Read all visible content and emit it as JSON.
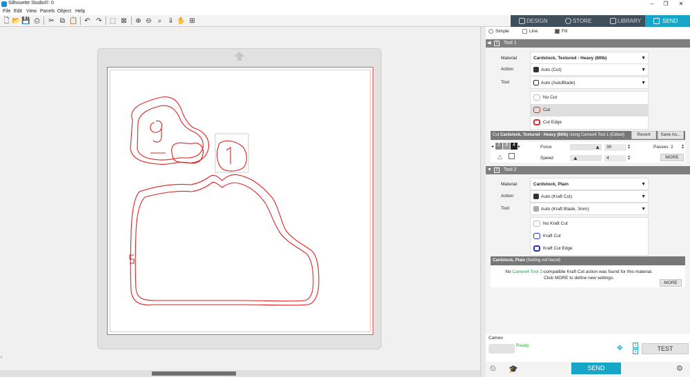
{
  "app": {
    "title": "Silhouette Studio®: 0"
  },
  "menu": [
    "File",
    "Edit",
    "View",
    "Panels",
    "Object",
    "Help"
  ],
  "nav_tabs": [
    {
      "label": "DESIGN",
      "active": false
    },
    {
      "label": "STORE",
      "active": false
    },
    {
      "label": "LIBRARY",
      "active": false
    },
    {
      "label": "SEND",
      "active": true
    }
  ],
  "colors": {
    "accent": "#18a6c8",
    "nav_bg": "#3f4f5c",
    "cut_line": "#e02020",
    "ready": "#22bb22"
  },
  "modes": [
    "Simple",
    "Line",
    "Fill"
  ],
  "tool1": {
    "header": "Tool 1",
    "material_label": "Material",
    "material_value": "Cardstock, Textured - Heavy (80lb)",
    "action_label": "Action",
    "action_value": "Auto (Cut)",
    "tool_label": "Tool",
    "tool_value": "Auto (AutoBlade)",
    "actions": [
      "No Cut",
      "Cut",
      "Cut Edge"
    ],
    "selected_action": "Cut",
    "info_prefix": "Cut ",
    "info_material": "Cardstock, Textured - Heavy (80lb)",
    "info_suffix": " Using Cameo4 Tool 1 (Edited)",
    "revert": "Revert",
    "save_as": "Save As...",
    "blade_nums": [
      "2",
      "3",
      "4"
    ],
    "force_label": "Force",
    "force_value": "30",
    "passes_label": "Passes",
    "passes_value": "2",
    "speed_label": "Speed",
    "speed_value": "4",
    "more": "MORE"
  },
  "tool2": {
    "header": "Tool 2",
    "material_label": "Material",
    "material_value": "Cardstock, Plain",
    "action_label": "Action",
    "action_value": "Auto (Kraft Cut)",
    "tool_label": "Tool",
    "tool_value": "Auto (Kraft Blade, 3mm)",
    "actions": [
      "No Kraft Cut",
      "Kraft Cut",
      "Kraft Cut Edge"
    ],
    "info_material": "Cardstock, Plain",
    "info_suffix": " (Setting not found)",
    "msg_pre": "No ",
    "msg_link": "Cameo4 Tool 2",
    "msg_post": "-compatible Kraft Cut action was found for this material.",
    "msg2": "Click MORE to define new settings.",
    "more": "MORE"
  },
  "device": {
    "name": "Cameo",
    "status": "Ready",
    "slot1": "1",
    "slot2": "2",
    "test": "TEST",
    "send": "SEND"
  },
  "canvas": {
    "labels": [
      "9",
      "1",
      "5"
    ]
  }
}
